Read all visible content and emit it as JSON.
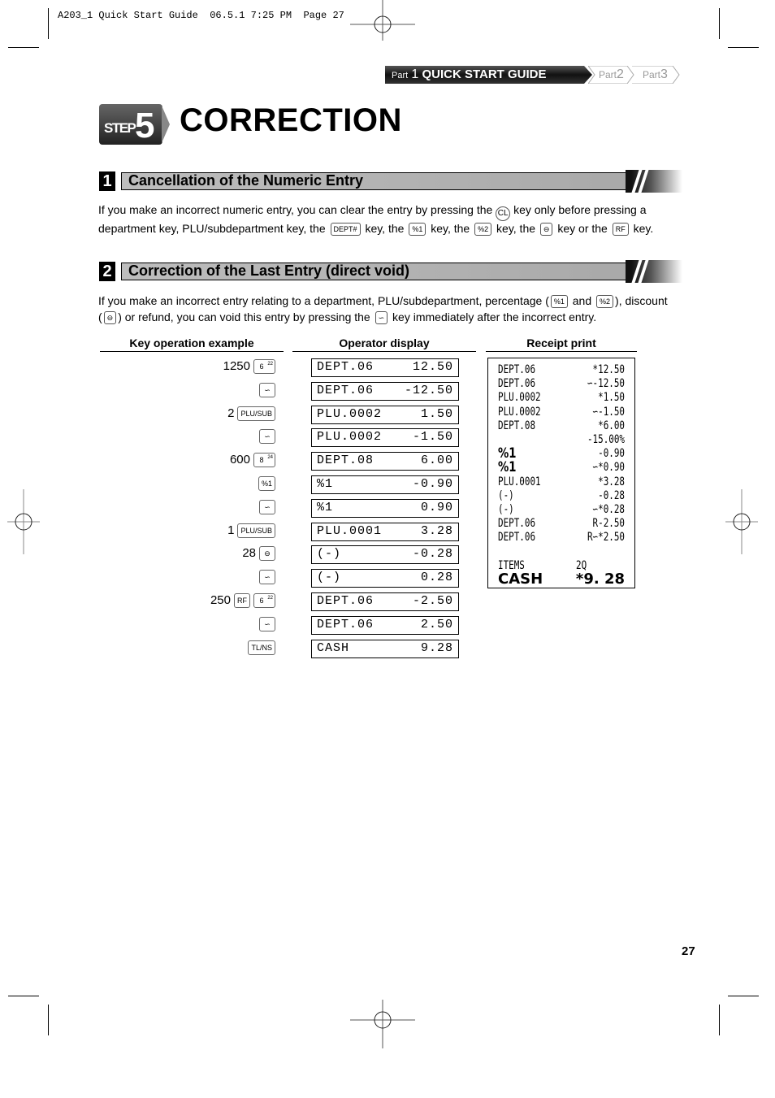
{
  "slug": "A203_1 Quick Start Guide  06.5.1 7:25 PM  Page 27",
  "part_nav": {
    "active": {
      "prefix": "Part",
      "num": "1",
      "label": "QUICK START GUIDE"
    },
    "others": [
      {
        "prefix": "Part",
        "num": "2"
      },
      {
        "prefix": "Part",
        "num": "3"
      }
    ]
  },
  "step": {
    "word": "STEP",
    "num": "5",
    "title": "CORRECTION"
  },
  "sections": [
    {
      "num": "1",
      "title": "Cancellation of the Numeric Entry",
      "text": {
        "a": "If you make an incorrect numeric entry, you can clear the entry by pressing the",
        "key_cl": "CL",
        "b": "key only before pressing a",
        "c": "department key, PLU/subdepartment key, the",
        "key_dept": "DEPT#",
        "d": "key, the",
        "key_p1": "%1",
        "e": "key, the",
        "key_p2": "%2",
        "f": "key, the",
        "key_minus": "⊖",
        "g": "key  or the",
        "key_rf": "RF",
        "h": "key."
      }
    },
    {
      "num": "2",
      "title": "Correction of the Last Entry (direct void)",
      "text": {
        "a": "If you make an incorrect entry relating to a department, PLU/subdepartment, percentage (",
        "key_p1": "%1",
        "b": "and",
        "key_p2": "%2",
        "c": "), discount",
        "d": "(",
        "key_minus": "⊖",
        "e": ") or refund, you can void this entry by pressing the",
        "key_void": "∽",
        "f": "key immediately after the incorrect entry."
      }
    }
  ],
  "example": {
    "headers": {
      "keys": "Key operation example",
      "display": "Operator display",
      "receipt": "Receipt print"
    },
    "rows": [
      {
        "num": "1250",
        "keys": [
          {
            "label": "6",
            "sup": "22"
          }
        ],
        "disp_l": "DEPT.06",
        "disp_r": "12.50"
      },
      {
        "num": "",
        "keys": [
          {
            "label": "∽"
          }
        ],
        "disp_l": "DEPT.06",
        "disp_r": "-12.50"
      },
      {
        "num": "2",
        "keys": [
          {
            "label": "PLU/SUB"
          }
        ],
        "disp_l": "PLU.0002",
        "disp_r": "1.50"
      },
      {
        "num": "",
        "keys": [
          {
            "label": "∽"
          }
        ],
        "disp_l": "PLU.0002",
        "disp_r": "-1.50"
      },
      {
        "num": "600",
        "keys": [
          {
            "label": "8",
            "sup": "24"
          }
        ],
        "disp_l": "DEPT.08",
        "disp_r": "6.00"
      },
      {
        "num": "",
        "keys": [
          {
            "label": "%1"
          }
        ],
        "disp_l": "%1",
        "disp_r": "-0.90"
      },
      {
        "num": "",
        "keys": [
          {
            "label": "∽"
          }
        ],
        "disp_l": "%1",
        "disp_r": "0.90"
      },
      {
        "num": "1",
        "keys": [
          {
            "label": "PLU/SUB"
          }
        ],
        "disp_l": "PLU.0001",
        "disp_r": "3.28"
      },
      {
        "num": "28",
        "keys": [
          {
            "label": "⊖"
          }
        ],
        "disp_l": "(-)",
        "disp_r": "-0.28"
      },
      {
        "num": "",
        "keys": [
          {
            "label": "∽"
          }
        ],
        "disp_l": "(-)",
        "disp_r": "0.28"
      },
      {
        "num": "250",
        "keys": [
          {
            "label": "RF"
          },
          {
            "label": "6",
            "sup": "22"
          }
        ],
        "disp_l": "DEPT.06",
        "disp_r": "-2.50"
      },
      {
        "num": "",
        "keys": [
          {
            "label": "∽"
          }
        ],
        "disp_l": "DEPT.06",
        "disp_r": "2.50"
      },
      {
        "num": "",
        "keys": [
          {
            "label": "TL/NS"
          }
        ],
        "disp_l": "CASH",
        "disp_r": "9.28"
      }
    ],
    "receipt": [
      {
        "l": "DEPT.06",
        "r": "*12.50"
      },
      {
        "l": "DEPT.06",
        "r": "∽-12.50"
      },
      {
        "l": "PLU.0002",
        "r": "*1.50"
      },
      {
        "l": "PLU.0002",
        "r": "∽-1.50"
      },
      {
        "l": "DEPT.08",
        "r": "*6.00"
      },
      {
        "l": "",
        "r": "-15.00%"
      },
      {
        "l": "%1",
        "r": "-0.90",
        "bold_l": true
      },
      {
        "l": "%1",
        "r": "∽*0.90",
        "bold_l": true
      },
      {
        "l": "PLU.0001",
        "r": "*3.28"
      },
      {
        "l": " (-)",
        "r": "-0.28"
      },
      {
        "l": " (-)",
        "r": "∽*0.28"
      },
      {
        "l": "DEPT.06",
        "r": "R-2.50"
      },
      {
        "l": "DEPT.06",
        "r": "R∽*2.50"
      },
      {
        "l": "",
        "r": ""
      },
      {
        "l": "ITEMS",
        "r": "2Q",
        "left_r": true
      },
      {
        "l": "CASH",
        "r": "*9. 28",
        "big": true
      }
    ]
  },
  "page_number": "27"
}
